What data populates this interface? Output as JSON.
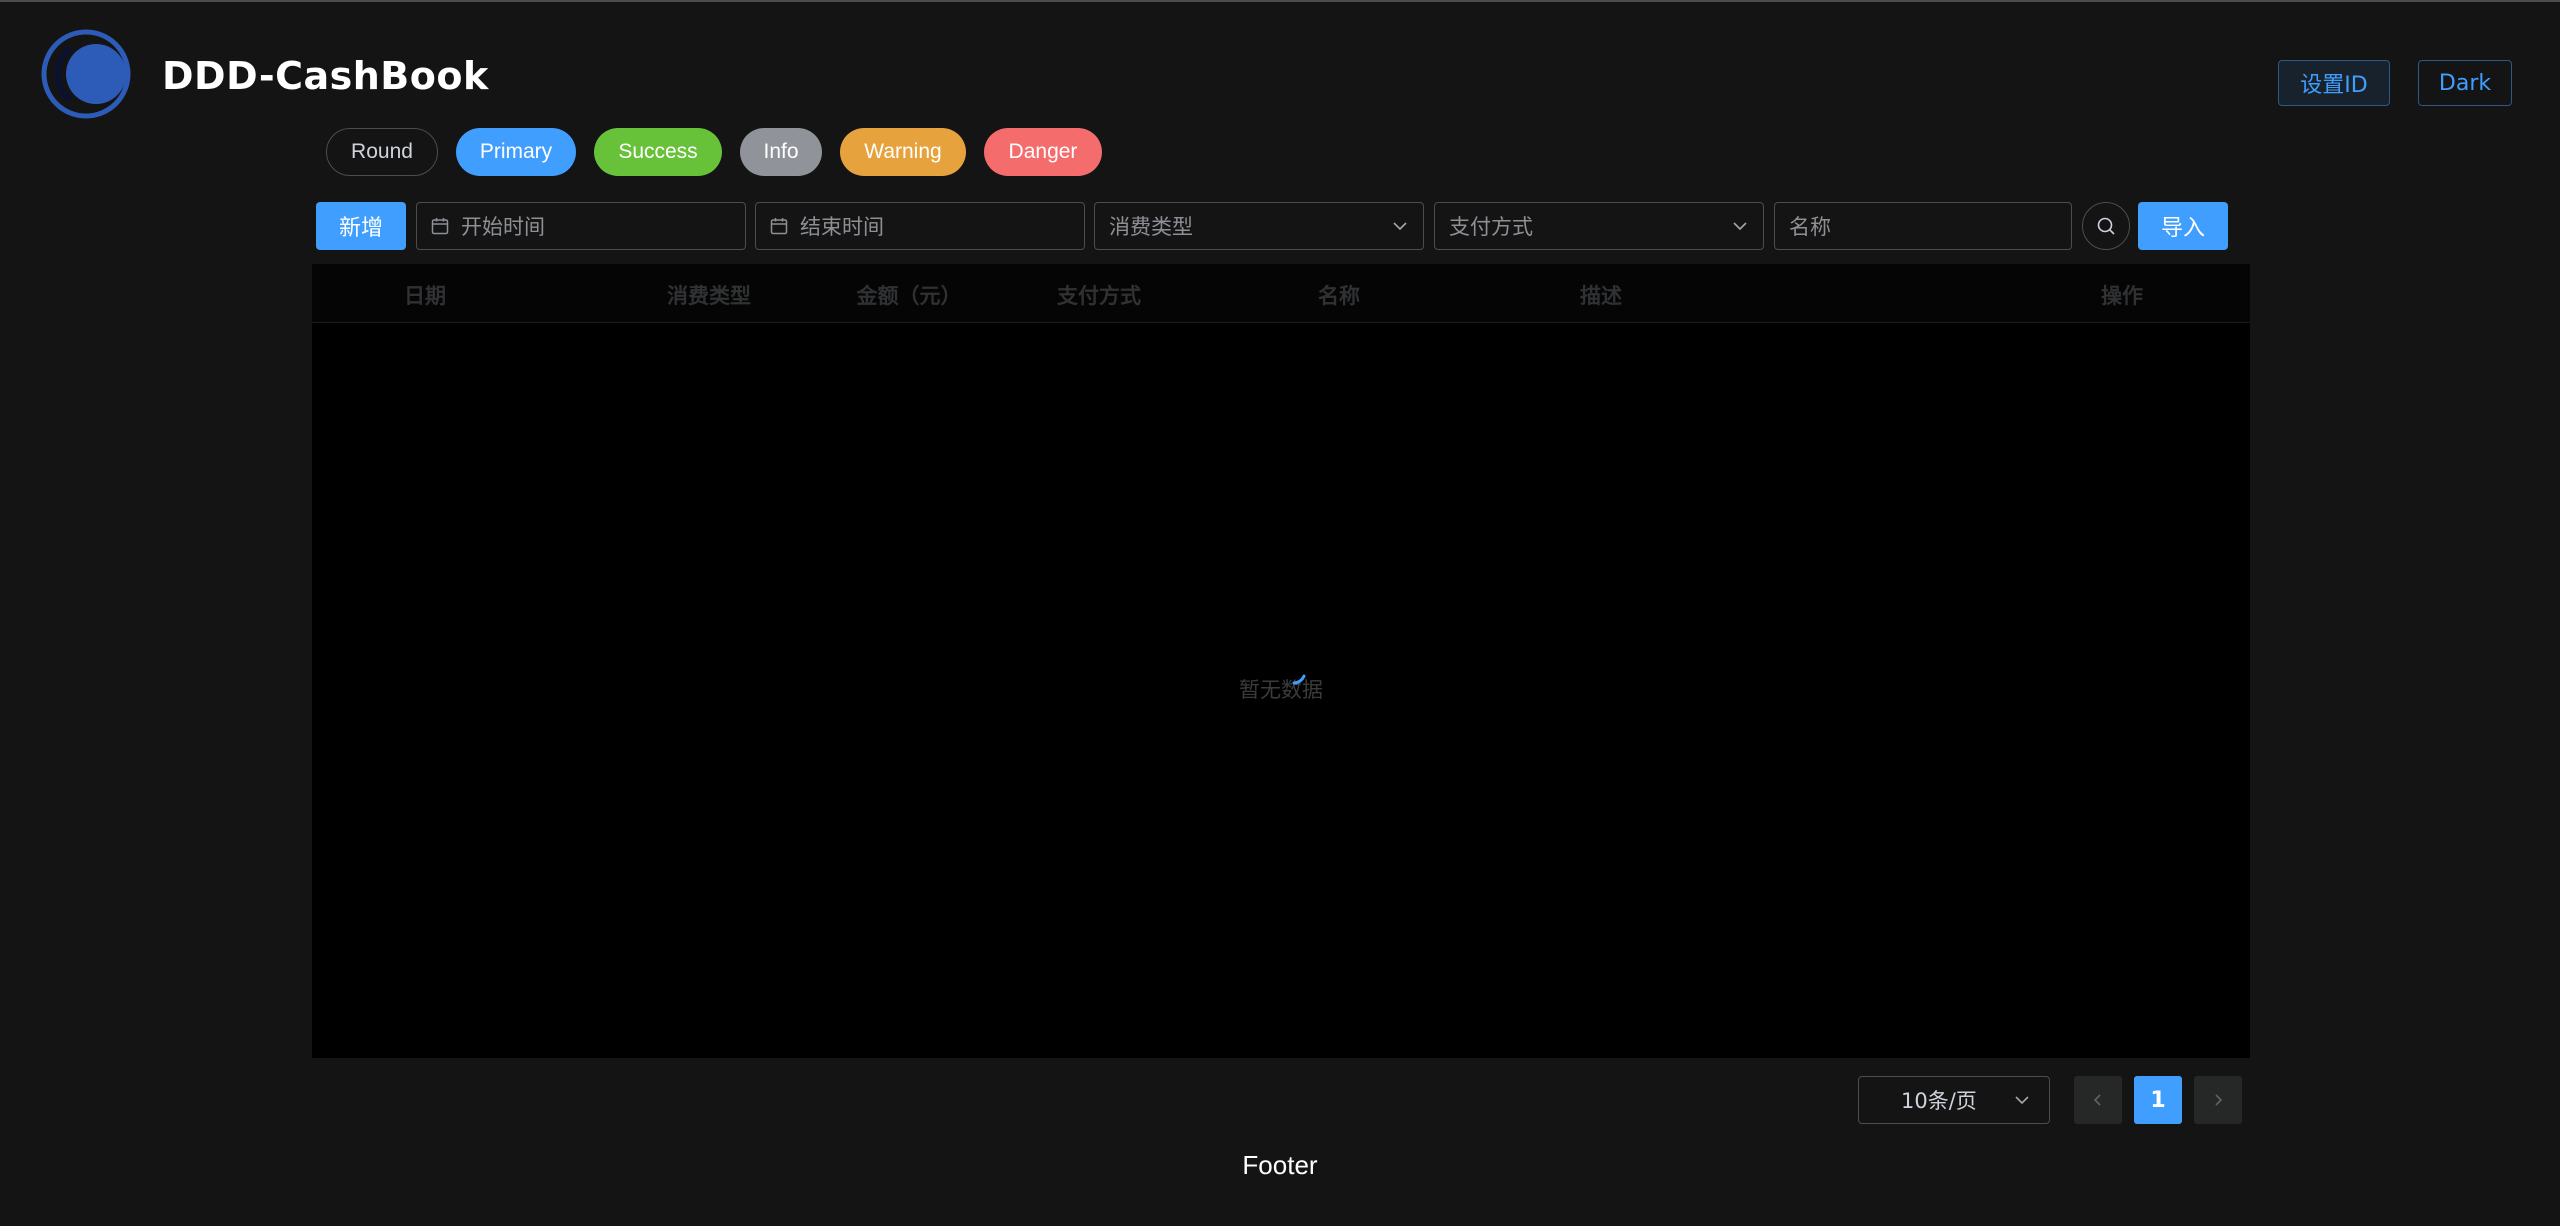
{
  "header": {
    "title": "DDD-CashBook",
    "set_id_label": "设置ID",
    "theme_label": "Dark"
  },
  "demo_buttons": {
    "round": "Round",
    "primary": "Primary",
    "success": "Success",
    "info": "Info",
    "warning": "Warning",
    "danger": "Danger"
  },
  "toolbar": {
    "add_label": "新增",
    "start_time_placeholder": "开始时间",
    "end_time_placeholder": "结束时间",
    "consume_type_placeholder": "消费类型",
    "pay_method_placeholder": "支付方式",
    "name_placeholder": "名称",
    "import_label": "导入"
  },
  "table": {
    "columns": [
      "日期",
      "消费类型",
      "金额（元）",
      "支付方式",
      "名称",
      "描述",
      "操作"
    ],
    "empty_text": "暂无数据"
  },
  "pagination": {
    "page_size": "10条/页",
    "current_page": "1"
  },
  "footer": {
    "text": "Footer"
  },
  "colors": {
    "primary": "#409eff",
    "success": "#67c23a",
    "info": "#909399",
    "warning": "#e6a23c",
    "danger": "#f56c6c",
    "background": "#141414"
  }
}
